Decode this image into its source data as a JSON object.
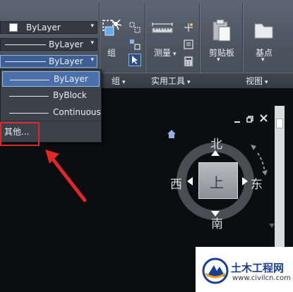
{
  "ribbon": {
    "color_dropdown": "ByLayer",
    "lineweight_dropdown": "ByLayer",
    "linetype_dropdown": "ByLayer",
    "group_label": "组",
    "utilities_label": "测量",
    "clipboard_label": "剪贴板",
    "base_label": "基点",
    "panel_labels": {
      "group": "组",
      "utilities": "实用工具",
      "view": "视图"
    },
    "arrow_glyph": "▾"
  },
  "linetype_menu": {
    "items": [
      {
        "label": "ByLayer",
        "selected": true
      },
      {
        "label": "ByBlock",
        "selected": false
      },
      {
        "label": "Continuous",
        "selected": false
      }
    ],
    "other_label": "其他..."
  },
  "viewcube": {
    "north": "北",
    "south": "南",
    "east": "东",
    "west": "西",
    "face": "上"
  },
  "watermark": {
    "title": "土木工程网",
    "url": "www.civilcn.com"
  },
  "colors": {
    "highlight": "#e02828",
    "selected_item": "#4b6fa8"
  }
}
